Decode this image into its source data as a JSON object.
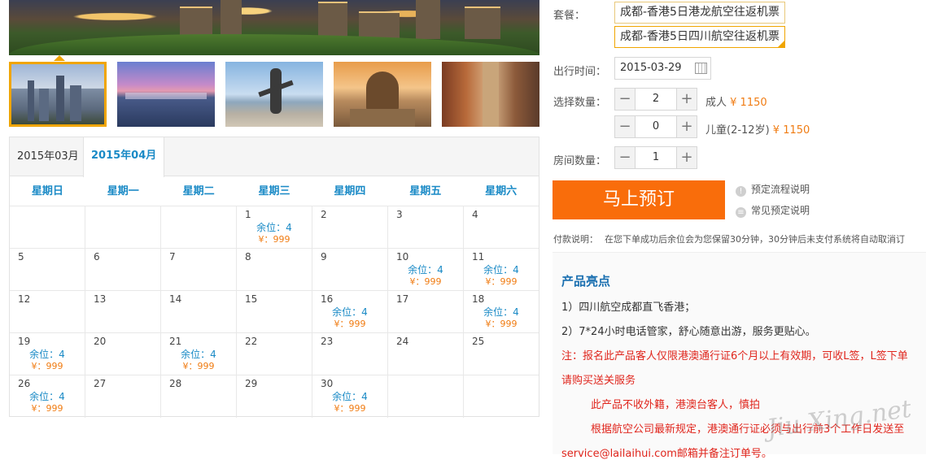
{
  "booking": {
    "package_label": "套餐：",
    "packages": [
      "成都-香港5日港龙航空往返机票",
      "成都-香港5日四川航空往返机票"
    ],
    "date_label": "出行时间：",
    "date_value": "2015-03-29",
    "quantity_label": "选择数量：",
    "adult_qty": "2",
    "adult_label": "成人",
    "adult_price": "¥ 1150",
    "child_qty": "0",
    "child_label": "儿童(2-12岁)",
    "child_price": "¥ 1150",
    "room_label": "房间数量：",
    "room_qty": "1",
    "minus": "−",
    "plus": "+",
    "book_label": "马上预订",
    "help_flow": "预定流程说明",
    "help_faq": "常见预定说明",
    "pay_key": "付款说明：",
    "pay_text": "在您下单成功后余位会为您保留30分钟，30分钟后未支付系统将自动取消订"
  },
  "calendar": {
    "tab_march": "2015年03月",
    "tab_april": "2015年04月",
    "weekdays": [
      "星期日",
      "星期一",
      "星期二",
      "星期三",
      "星期四",
      "星期五",
      "星期六"
    ],
    "weeks": [
      [
        {
          "d": ""
        },
        {
          "d": ""
        },
        {
          "d": ""
        },
        {
          "d": "1",
          "s": "余位：4",
          "p": "¥：999"
        },
        {
          "d": "2"
        },
        {
          "d": "3"
        },
        {
          "d": "4"
        }
      ],
      [
        {
          "d": "5"
        },
        {
          "d": "6"
        },
        {
          "d": "7"
        },
        {
          "d": "8"
        },
        {
          "d": "9"
        },
        {
          "d": "10",
          "s": "余位：4",
          "p": "¥：999"
        },
        {
          "d": "11",
          "s": "余位：4",
          "p": "¥：999"
        }
      ],
      [
        {
          "d": "12"
        },
        {
          "d": "13"
        },
        {
          "d": "14"
        },
        {
          "d": "15"
        },
        {
          "d": "16",
          "s": "余位：4",
          "p": "¥：999"
        },
        {
          "d": "17"
        },
        {
          "d": "18",
          "s": "余位：4",
          "p": "¥：999"
        }
      ],
      [
        {
          "d": "19",
          "s": "余位：4",
          "p": "¥：999"
        },
        {
          "d": "20"
        },
        {
          "d": "21",
          "s": "余位：4",
          "p": "¥：999"
        },
        {
          "d": "22"
        },
        {
          "d": "23"
        },
        {
          "d": "24"
        },
        {
          "d": "25"
        }
      ],
      [
        {
          "d": "26",
          "s": "余位：4",
          "p": "¥：999"
        },
        {
          "d": "27"
        },
        {
          "d": "28"
        },
        {
          "d": "29"
        },
        {
          "d": "30",
          "s": "余位：4",
          "p": "¥：999"
        },
        {
          "d": ""
        },
        {
          "d": ""
        }
      ]
    ]
  },
  "highlights": {
    "title": "产品亮点",
    "l1": "1）四川航空成都直飞香港；",
    "l2": "2）7*24小时电话管家，舒心随意出游，服务更贴心。",
    "l3": "注：报名此产品客人仅限港澳通行证6个月以上有效期，可收L签，L签下单",
    "l4": "请购买送关服务",
    "l5": "此产品不收外籍，港澳台客人，慎拍",
    "l6": "根据航空公司最新规定，港澳通行证必须与出行前3个工作日发送至",
    "l7": "service@lailaihui.com邮箱并备注订单号。"
  },
  "watermark": "Jiu Xing.net"
}
